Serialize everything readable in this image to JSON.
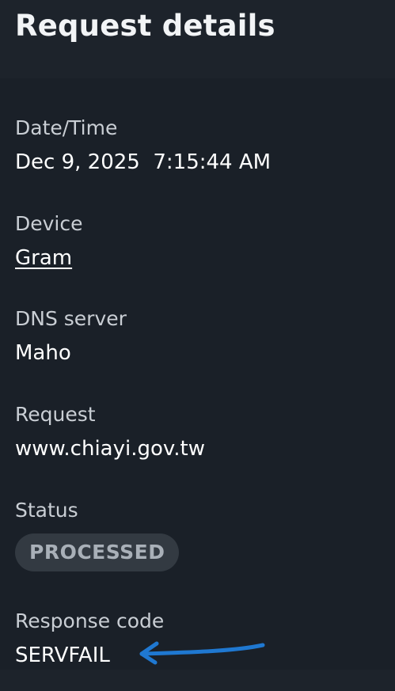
{
  "title": "Request details",
  "fields": {
    "datetime": {
      "label": "Date/Time",
      "value": "Dec 9, 2025  7:15:44 AM"
    },
    "device": {
      "label": "Device",
      "value": "Gram"
    },
    "dns_server": {
      "label": "DNS server",
      "value": "Maho"
    },
    "request": {
      "label": "Request",
      "value": "www.chiayi.gov.tw"
    },
    "status": {
      "label": "Status",
      "value": "PROCESSED"
    },
    "response_code": {
      "label": "Response code",
      "value": "SERVFAIL"
    }
  },
  "annotation": {
    "icon": "arrow-left-icon",
    "color": "#1f78d1"
  },
  "colors": {
    "background": "#1a2028",
    "header_background": "#1d232b",
    "badge_background": "#333a42",
    "badge_text": "#a9b0b8"
  }
}
